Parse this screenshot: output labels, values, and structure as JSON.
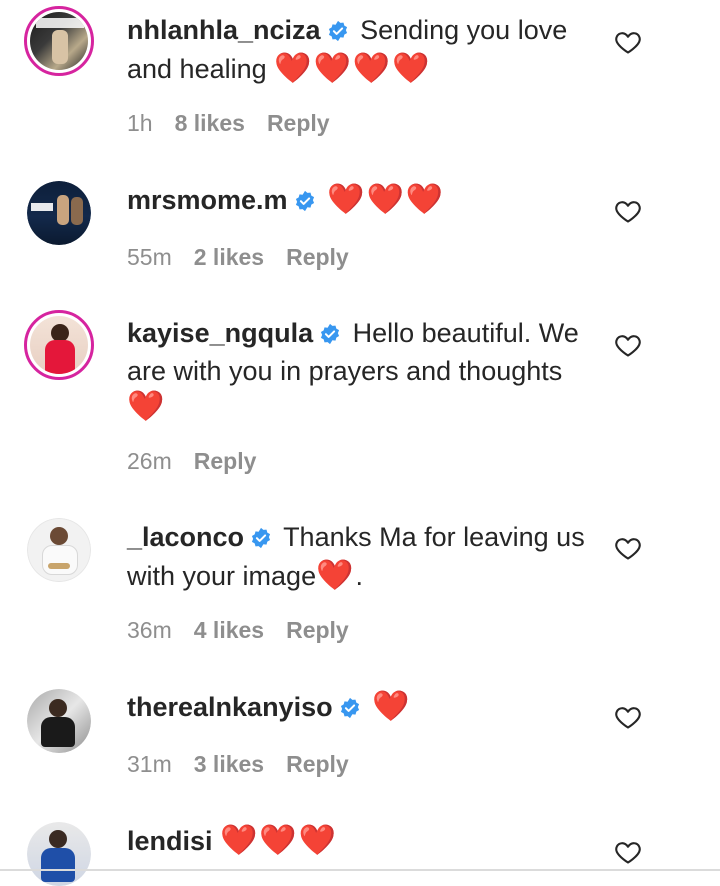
{
  "colors": {
    "verified_badge": "#3897f0",
    "heart": "#e0161c",
    "meta_text": "#8e8e8e",
    "story_ring": "#d6249f"
  },
  "comments": [
    {
      "username": "nhlanhla_nciza",
      "verified": true,
      "text": "Sending you love and healing",
      "emoji": "❤️❤️❤️❤️",
      "time": "1h",
      "likes": "8 likes",
      "reply": "Reply",
      "avatar_icon": "user-avatar-icon"
    },
    {
      "username": "mrsmome.m",
      "verified": true,
      "text": "",
      "emoji": "❤️❤️❤️",
      "time": "55m",
      "likes": "2 likes",
      "reply": "Reply",
      "avatar_icon": "user-avatar-icon"
    },
    {
      "username": "kayise_ngqula",
      "verified": true,
      "text": "Hello beautiful. We are with you in prayers and thoughts",
      "emoji": "❤️",
      "time": "26m",
      "likes": "",
      "reply": "Reply",
      "avatar_icon": "user-avatar-icon"
    },
    {
      "username": "_laconco",
      "verified": true,
      "text": "Thanks Ma for leaving us with your image",
      "emoji": "❤️",
      "text_suffix": ".",
      "time": "36m",
      "likes": "4 likes",
      "reply": "Reply",
      "avatar_icon": "user-avatar-icon"
    },
    {
      "username": "therealnkanyiso",
      "verified": true,
      "text": "",
      "emoji": "❤️",
      "time": "31m",
      "likes": "3 likes",
      "reply": "Reply",
      "avatar_icon": "user-avatar-icon"
    },
    {
      "username": "lendisi",
      "verified": false,
      "text": "",
      "emoji": "❤️❤️❤️",
      "time": "",
      "likes": "",
      "reply": "",
      "avatar_icon": "user-avatar-icon"
    }
  ]
}
